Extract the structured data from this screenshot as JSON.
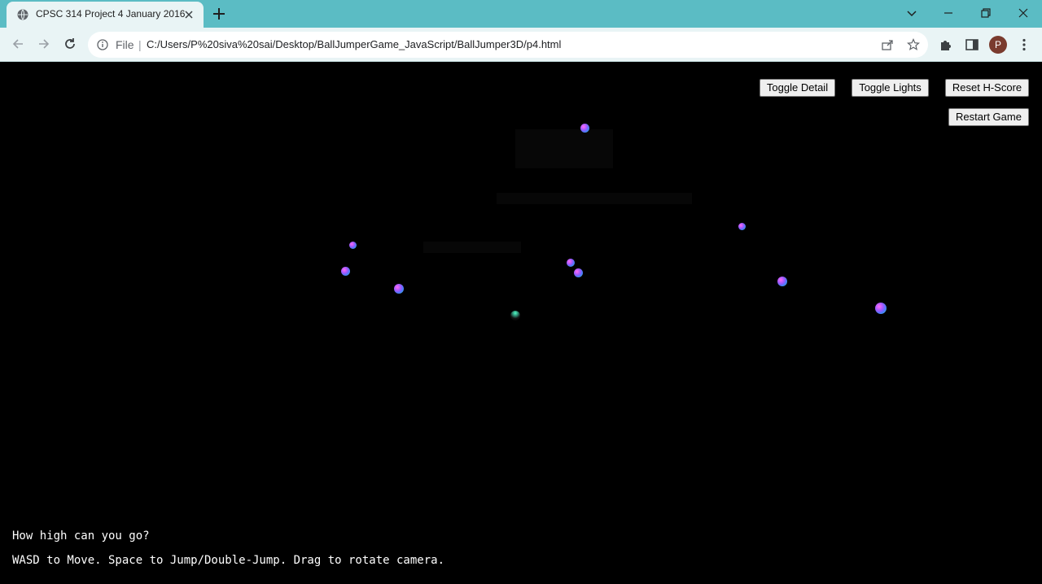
{
  "browser": {
    "tab_title": "CPSC 314 Project 4 January 2016",
    "address_scheme": "File",
    "address_url": "C:/Users/P%20siva%20sai/Desktop/BallJumperGame_JavaScript/BallJumper3D/p4.html",
    "profile_initial": "P"
  },
  "buttons": {
    "toggle_detail": "Toggle Detail",
    "toggle_lights": "Toggle Lights",
    "reset_hscore": "Reset H-Score",
    "restart_game": "Restart Game"
  },
  "info": {
    "line1": "How high can you go?",
    "line2": "WASD to Move. Space to Jump/Double-Jump. Drag to rotate camera."
  },
  "colors": {
    "titlebar": "#5bbcc4",
    "toolbar": "#e9f4f5",
    "viewport": "#000000"
  }
}
